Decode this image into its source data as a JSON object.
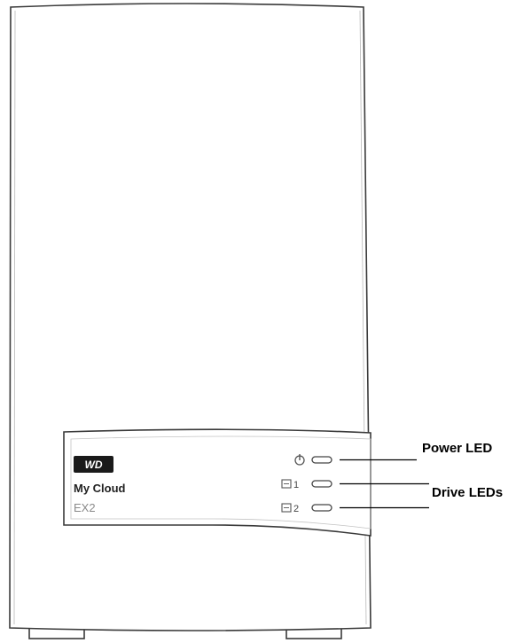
{
  "device": {
    "logo_text": "WD",
    "model_line1": "My Cloud",
    "model_line2": "EX2",
    "drive1_number": "1",
    "drive2_number": "2"
  },
  "callouts": {
    "power_led": "Power LED",
    "drive_leds": "Drive LEDs"
  },
  "icons": [
    "power-icon",
    "drive-icon"
  ],
  "colors": {
    "outline": "#3a3a3a",
    "logo_bg": "#1a1a1a",
    "model_line2": "#8a8a8a"
  }
}
